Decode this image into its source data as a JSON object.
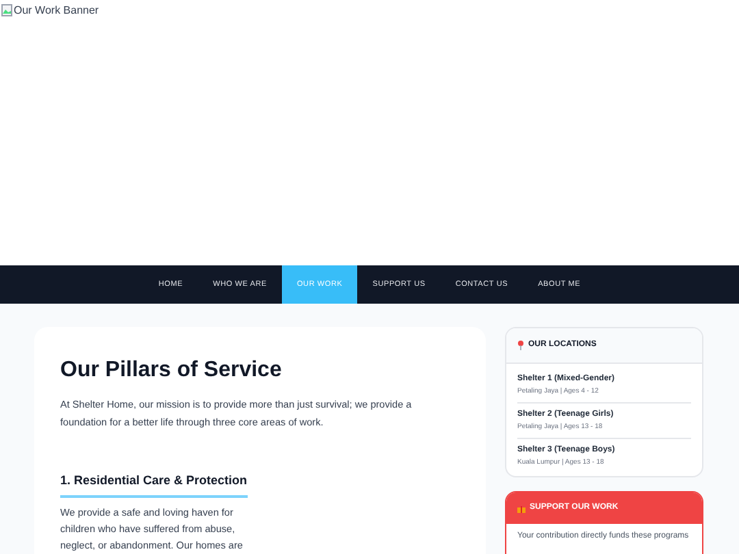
{
  "banner": {
    "alt": "Our Work Banner"
  },
  "nav": [
    {
      "label": "HOME",
      "selected": false
    },
    {
      "label": "WHO WE ARE",
      "selected": false
    },
    {
      "label": "OUR WORK",
      "selected": true
    },
    {
      "label": "SUPPORT US",
      "selected": false
    },
    {
      "label": "CONTACT US",
      "selected": false
    },
    {
      "label": "ABOUT ME",
      "selected": false
    }
  ],
  "main": {
    "title": "Our Pillars of Service",
    "intro": "At Shelter Home, our mission is to provide more than just survival; we provide a foundation for a better life through three core areas of work.",
    "sections": [
      {
        "heading": "1. Residential Care & Protection",
        "text": "We provide a safe and loving haven for children who have suffered from abuse, neglect, or abandonment. Our homes are"
      }
    ]
  },
  "locations": {
    "title": "OUR LOCATIONS",
    "items": [
      {
        "name": "Shelter 1 (Mixed-Gender)",
        "detail": "Petaling Jaya | Ages 4 - 12"
      },
      {
        "name": "Shelter 2 (Teenage Girls)",
        "detail": "Petaling Jaya | Ages 13 - 18"
      },
      {
        "name": "Shelter 3 (Teenage Boys)",
        "detail": "Kuala Lumpur | Ages 13 - 18"
      }
    ]
  },
  "support": {
    "title": "SUPPORT OUR WORK",
    "text": "Your contribution directly funds these programs"
  }
}
